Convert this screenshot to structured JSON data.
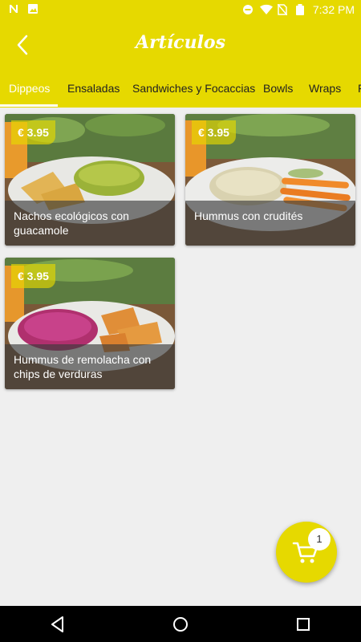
{
  "status_bar": {
    "time": "7:32 PM"
  },
  "header": {
    "title": "Artículos"
  },
  "tabs": [
    {
      "label": "Dippeos"
    },
    {
      "label": "Ensaladas"
    },
    {
      "label": "Sandwiches y Focaccias"
    },
    {
      "label": "Bowls"
    },
    {
      "label": "Wraps"
    },
    {
      "label": "F"
    }
  ],
  "active_tab": "Dippeos",
  "products": [
    {
      "price": "€ 3.95",
      "name": "Nachos ecológicos con guacamole"
    },
    {
      "price": "€ 3.95",
      "name": "Hummus con crudités"
    },
    {
      "price": "€ 3.95",
      "name": "Hummus de remolacha con chips de verduras"
    }
  ],
  "cart": {
    "count": "1"
  },
  "colors": {
    "brand": "#e6d900",
    "background": "#efefef"
  }
}
